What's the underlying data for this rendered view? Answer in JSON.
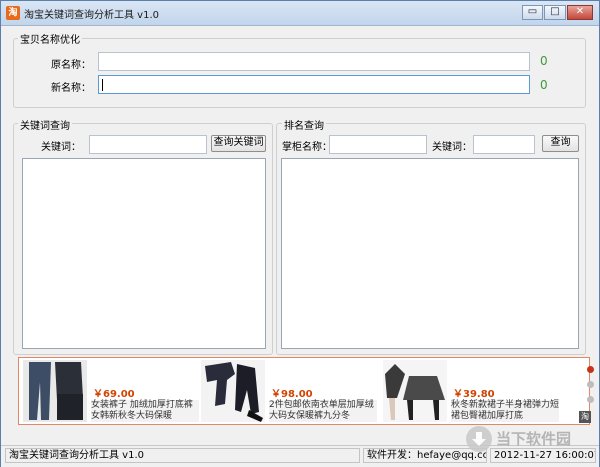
{
  "window": {
    "title": "淘宝关键词查询分析工具 v1.0",
    "icon_glyph": "淘",
    "minimize_glyph": "▭",
    "maximize_glyph": "□",
    "close_glyph": "✕"
  },
  "name_optimize": {
    "group_label": "宝贝名称优化",
    "original_label": "原名称：",
    "original_value": "",
    "original_count": "0",
    "new_label": "新名称：",
    "new_value": "",
    "new_count": "0"
  },
  "keyword_query": {
    "group_label": "关键词查询",
    "keyword_label": "关键词：",
    "keyword_value": "",
    "query_button": "查询关键词"
  },
  "ranking_query": {
    "group_label": "排名查询",
    "shop_label": "掌柜名称：",
    "shop_value": "",
    "keyword_label": "关键词：",
    "keyword_value": "",
    "query_button": "查询"
  },
  "ads": [
    {
      "price": "￥69.00",
      "desc": "女装裤子 加绒加厚打底裤 女韩新秋冬大码保暖"
    },
    {
      "price": "￥98.00",
      "desc": "2件包邮依南衣单层加厚绒大码女保暖裤九分冬"
    },
    {
      "price": "￥39.80",
      "desc": "秋冬新款裙子半身裙弹力短裙包臀裙加厚打底"
    }
  ],
  "ad_badge": "淘",
  "status": {
    "app_name": "淘宝关键词查询分析工具 v1.0",
    "developer": "软件开发：hefaye@qq.com",
    "datetime": "2012-11-27 16:00:07"
  },
  "watermark": {
    "text": "当下软件园"
  },
  "colors": {
    "accent": "#e86a1a",
    "count_green": "#3a9a3a",
    "price_red": "#d24400"
  }
}
